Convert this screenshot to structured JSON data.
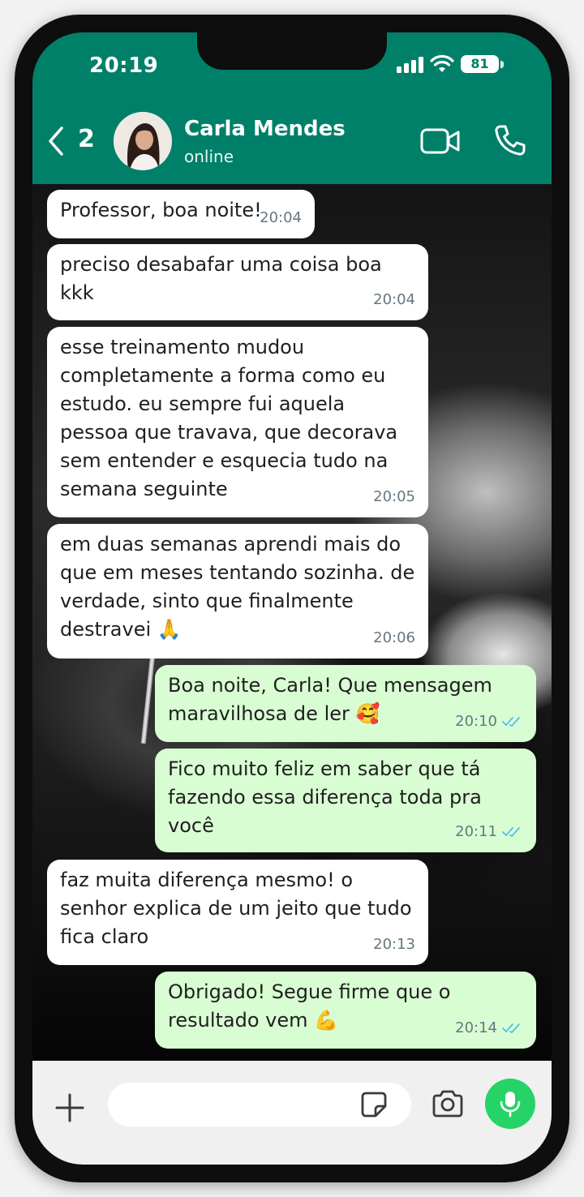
{
  "status_bar": {
    "time": "20:19",
    "battery": "81"
  },
  "header": {
    "back_count": "2",
    "contact_name": "Carla Mendes",
    "contact_status": "online"
  },
  "messages": [
    {
      "direction": "in",
      "text": "Professor, boa noite!",
      "time": "20:04"
    },
    {
      "direction": "in",
      "text": "preciso desabafar uma coisa boa kkk",
      "time": "20:04"
    },
    {
      "direction": "in",
      "text": "esse treinamento mudou completamente a forma como eu estudo. eu sempre fui aquela pessoa que travava, que decorava sem entender e esquecia tudo na semana seguinte",
      "time": "20:05"
    },
    {
      "direction": "in",
      "text": "em duas semanas aprendi mais do que em meses tentando sozinha. de verdade, sinto que finalmente destravei 🙏",
      "time": "20:06"
    },
    {
      "direction": "out",
      "text": "Boa noite, Carla! Que mensagem maravilhosa de ler 🥰",
      "time": "20:10",
      "status": "read"
    },
    {
      "direction": "out",
      "text": "Fico muito feliz em saber que tá fazendo essa diferença toda pra você",
      "time": "20:11",
      "status": "read"
    },
    {
      "direction": "in",
      "text": "faz muita diferença mesmo! o senhor explica de um jeito que tudo fica claro",
      "time": "20:13"
    },
    {
      "direction": "out",
      "text": "Obrigado! Segue firme que o resultado vem 💪",
      "time": "20:14",
      "status": "read"
    }
  ],
  "composer": {
    "input_value": "",
    "input_placeholder": ""
  },
  "colors": {
    "header": "#008069",
    "incoming_bubble": "#ffffff",
    "outgoing_bubble": "#d9fdd3",
    "mic_button": "#25d366",
    "read_ticks": "#53bdeb"
  },
  "icons": [
    "back-chevron-icon",
    "video-call-icon",
    "phone-call-icon",
    "plus-icon",
    "sticker-icon",
    "camera-icon",
    "microphone-icon",
    "double-check-icon",
    "signal-icon",
    "wifi-icon",
    "battery-icon"
  ]
}
